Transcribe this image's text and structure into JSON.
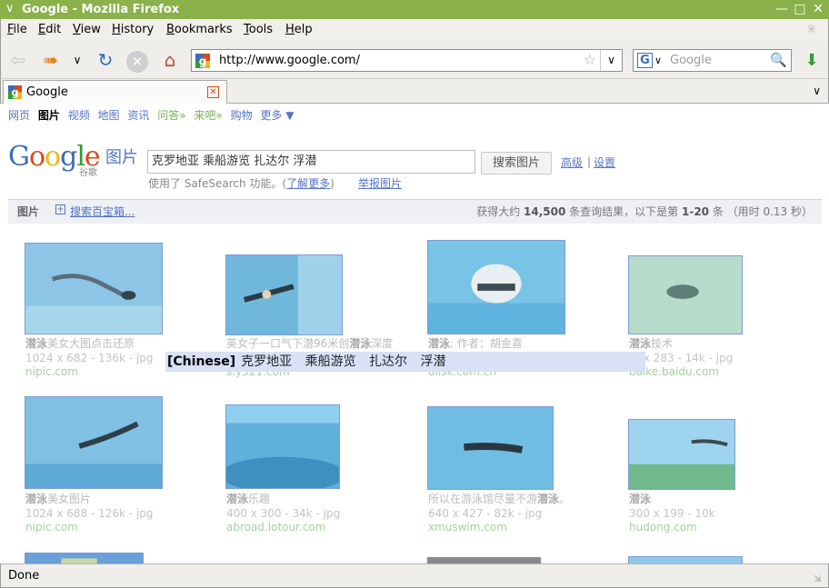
{
  "window": {
    "title": "Google - Mozilla Firefox"
  },
  "menu": [
    "File",
    "Edit",
    "View",
    "History",
    "Bookmarks",
    "Tools",
    "Help"
  ],
  "menu_underline": [
    "F",
    "E",
    "V",
    "H",
    "B",
    "T",
    "H"
  ],
  "menu_rest": [
    "ile",
    "dit",
    "iew",
    "istory",
    "ookmarks",
    "ools",
    "elp"
  ],
  "toolbar": {
    "url": "http://www.google.com/",
    "search_placeholder": "Google"
  },
  "tab": {
    "label": "Google"
  },
  "google": {
    "nav": [
      "网页",
      "图片",
      "视频",
      "地图",
      "资讯",
      "问答»",
      "来吧»",
      "购物",
      "更多 ▼"
    ],
    "logo_text": "Google",
    "logo_sub": "谷歌",
    "logo_section": "图片",
    "query": "克罗地亚  乘船游览  扎达尔  浮潜",
    "search_button": "搜索图片",
    "advanced": "高级",
    "settings": "设置",
    "safesearch_prefix": "使用了 SafeSearch 功能。(",
    "safesearch_link": "了解更多",
    "safesearch_suffix": ")",
    "report": "举报图片",
    "results_label": "图片",
    "baibao": "搜索百宝箱...",
    "stats_prefix": "获得大约 ",
    "stats_count": "14,500",
    "stats_mid": " 条查询结果，以下是第 ",
    "stats_range": "1-20",
    "stats_suffix": " 条 （用时 0.13 秒）"
  },
  "results": [
    {
      "title_bold": "潜泳",
      "title_rest": "美女大图点击还原",
      "meta": "1024 x 682 - 136k - jpg",
      "site": "nipic.com"
    },
    {
      "title_pre": "英女子一口气下潜96米创",
      "title_bold": "潜泳",
      "title_rest": "深度",
      "meta": "",
      "site": "s.y521.com"
    },
    {
      "title_bold": "潜泳",
      "title_rest": "; 作者：胡金喜",
      "meta": "",
      "site": "dlisk.com.cn"
    },
    {
      "title_bold": "潜泳",
      "title_rest": "技术",
      "meta": "… x 283 - 14k - jpg",
      "site": "baike.baidu.com"
    },
    {
      "title_bold": "潜泳",
      "title_rest": "美女图片",
      "meta": "1024 x 688 - 126k - jpg",
      "site": "nipic.com"
    },
    {
      "title_bold": "潜泳",
      "title_rest": "乐趣",
      "meta": "400 x 300 - 34k - jpg",
      "site": "abroad.lotour.com"
    },
    {
      "title_pre": "所以在游泳馆尽量不游",
      "title_bold": "潜泳",
      "title_rest": "。",
      "meta": "640 x 427 - 82k - jpg",
      "site": "xmuswim.com"
    },
    {
      "title_bold": "潜泳",
      "title_rest": "",
      "meta": "300 x 199 - 10k",
      "site": "hudong.com"
    }
  ],
  "ime": {
    "tag": "[Chinese]",
    "candidates": "克罗地亚  乘船游览  扎达尔  浮潜"
  },
  "status": {
    "text": "Done"
  },
  "colors": {
    "titlebar": "#8ab14a",
    "link": "#5474c6",
    "green_link": "#72b34f",
    "ime_bg": "#d8e1f5"
  }
}
